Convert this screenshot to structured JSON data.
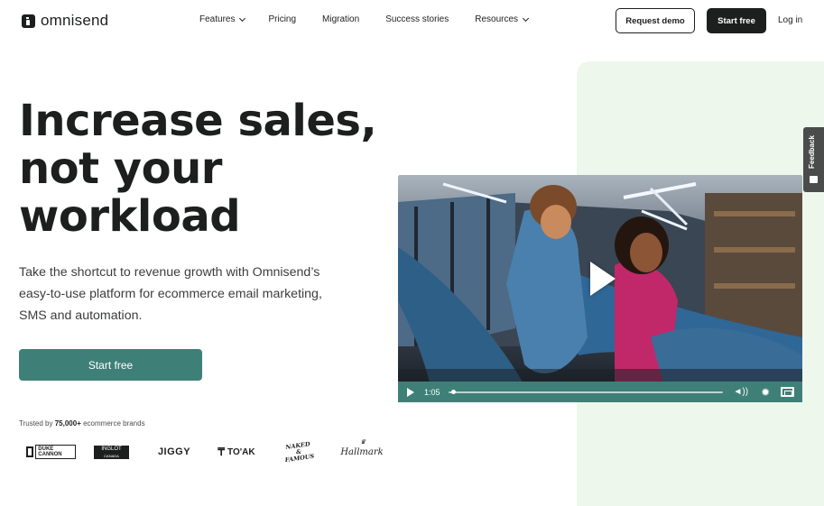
{
  "header": {
    "logo_text": "omnisend",
    "nav": [
      {
        "label": "Features",
        "dropdown": true
      },
      {
        "label": "Pricing",
        "dropdown": false
      },
      {
        "label": "Migration",
        "dropdown": false
      },
      {
        "label": "Success stories",
        "dropdown": false
      },
      {
        "label": "Resources",
        "dropdown": true
      }
    ],
    "request_demo": "Request demo",
    "start_free": "Start free",
    "login": "Log in"
  },
  "hero": {
    "headline_lines": [
      "Increase sales,",
      "not your",
      "workload"
    ],
    "subhead_lines": [
      "Take the shortcut to revenue growth with Omnisend’s",
      "easy-to-use platform for ecommerce email marketing,",
      "SMS and automation."
    ],
    "cta": "Start free",
    "trusted_prefix": "Trusted by",
    "trusted_count": "75,000+",
    "trusted_suffix": "ecommerce brands"
  },
  "brands": {
    "duke": "DUKE CANNON",
    "inglot_top": "INGLOT",
    "inglot_bottom": "CANADA",
    "jiggy": "JIGGY",
    "toak": "TO'AK",
    "naked": "NAKED & FAMOUS",
    "hallmark": "Hallmark"
  },
  "video": {
    "time": "1:05",
    "progress": 0.01,
    "icons": [
      "play-icon",
      "volume-icon",
      "settings-gear-icon",
      "fullscreen-icon"
    ]
  },
  "feedback": {
    "label": "Feedback"
  },
  "colors": {
    "brand_green": "#3e8077",
    "panel_green": "#eef7ec",
    "dark": "#1d1f1e"
  }
}
